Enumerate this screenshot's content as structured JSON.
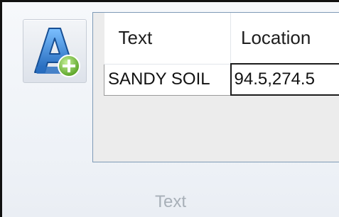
{
  "ribbon_group": {
    "label": "Text",
    "add_button": {
      "icon": "add-text-icon"
    }
  },
  "grid": {
    "columns": [
      "Text",
      "Location"
    ],
    "rows": [
      [
        "SANDY SOIL",
        "94.5,274.5"
      ]
    ]
  },
  "colors": {
    "icon_letter": "#2f7fd0",
    "icon_plus": "#6abf2a",
    "panel_border": "#7e9ab6"
  }
}
